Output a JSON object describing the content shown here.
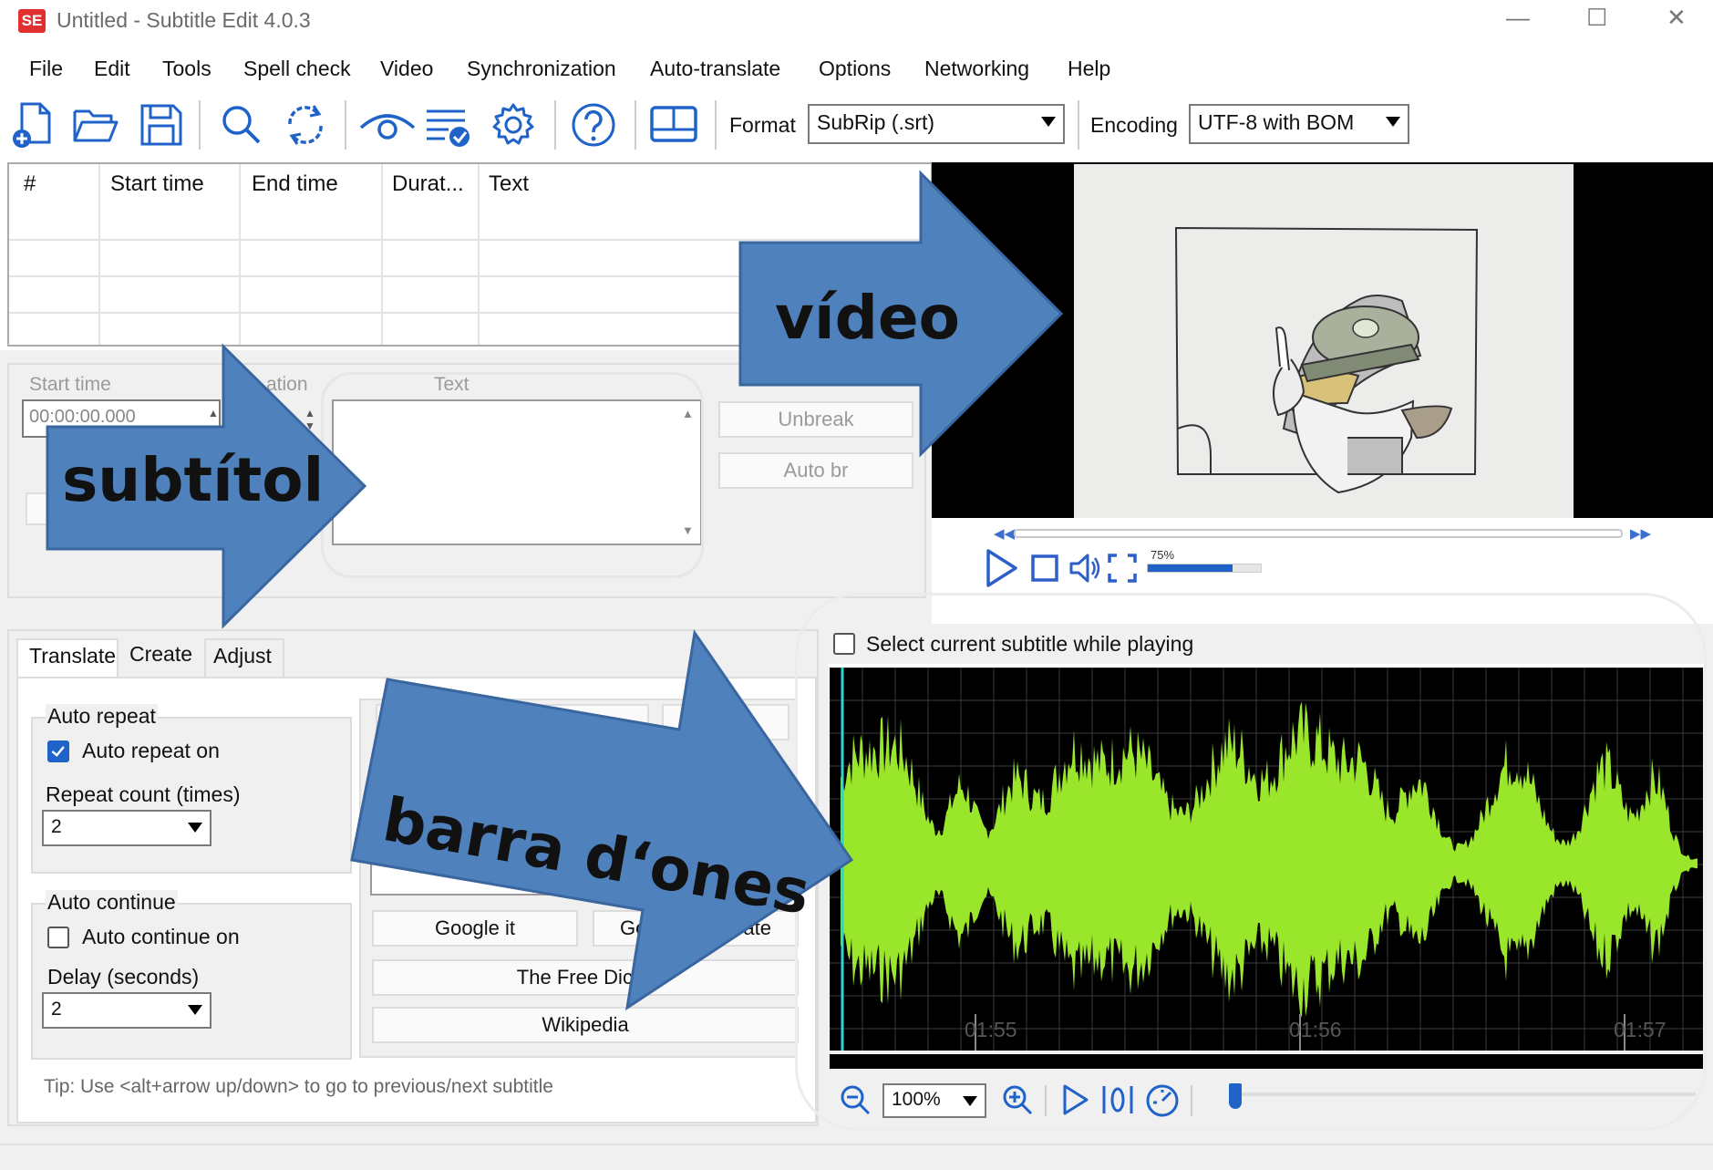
{
  "window": {
    "title": "Untitled - Subtitle Edit 4.0.3",
    "app_icon_text": "SE",
    "minimize": "—",
    "maximize": "☐",
    "close": "✕"
  },
  "menu": [
    "File",
    "Edit",
    "Tools",
    "Spell check",
    "Video",
    "Synchronization",
    "Auto-translate",
    "Options",
    "Networking",
    "Help"
  ],
  "toolbar": {
    "icons": [
      "new-file-icon",
      "open-folder-icon",
      "save-icon",
      "search-icon",
      "replace-icon",
      "preview-eye-icon",
      "spellcheck-icon",
      "settings-gear-icon",
      "help-icon",
      "layout-icon"
    ],
    "format_label": "Format",
    "format_value": "SubRip (.srt)",
    "encoding_label": "Encoding",
    "encoding_value": "UTF-8 with BOM"
  },
  "grid": {
    "columns": [
      "#",
      "Start time",
      "End time",
      "Durat...",
      "Text"
    ]
  },
  "edit": {
    "start_time_label": "Start time",
    "duration_label": "ation",
    "start_time_value": "00:00:00.000",
    "text_label": "Text",
    "unbreak": "Unbreak",
    "auto_br": "Auto br"
  },
  "video": {
    "volume": "75%"
  },
  "tabs": [
    "Translate",
    "Create",
    "Adjust"
  ],
  "translate": {
    "auto_repeat_group": "Auto repeat",
    "auto_repeat_on": "Auto repeat on",
    "auto_repeat_checked": true,
    "repeat_count_label": "Repeat count (times)",
    "repeat_count_value": "2",
    "auto_continue_group": "Auto continue",
    "auto_continue_on": "Auto continue on",
    "auto_continue_checked": false,
    "delay_label": "Delay (seconds)",
    "delay_value": "2",
    "google_it": "Google it",
    "google_translate_partial": "Go",
    "google_translate_tail": "ate",
    "free_dictionary": "The Free Dictio",
    "wikipedia": "Wikipedia",
    "tip": "Tip: Use <alt+arrow up/down> to go to previous/next subtitle"
  },
  "waveform": {
    "select_current": "Select current subtitle while playing",
    "select_current_checked": false,
    "times": [
      "01:55",
      "01:56",
      "01:57"
    ],
    "zoom": "100%",
    "wave_color": "#9ae62a"
  },
  "callouts": {
    "video": "vídeo",
    "subtitle": "subtítol",
    "waveform": "barra d‘ones",
    "arrow_color": "#4f81bd"
  }
}
